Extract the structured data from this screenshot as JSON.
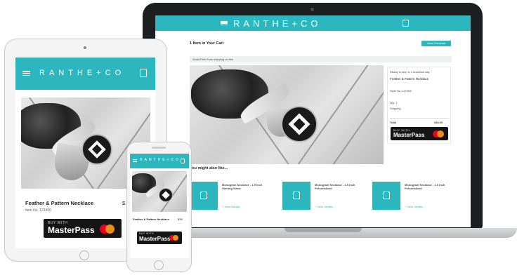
{
  "brand": {
    "logo": "RANTHE+CO"
  },
  "laptop": {
    "cart_title": "1 Item in Your Cart",
    "checkout_label": "View Checkout",
    "notice": "Great Pick! Free shipping on this",
    "product": {
      "ready_text": "Ready to ship in 1 business day",
      "name": "Feather & Pattern Necklace",
      "details": "Style No. 121456",
      "qty_label": "Qty: 1",
      "shipping_label": "Shipping",
      "total_label": "Total",
      "total_value": "$38.00"
    },
    "recs_title": "You might also like...",
    "recs": [
      {
        "title": "Monogram Necklace - 1.5 inch Sterling Silver",
        "link": "+ View Details"
      },
      {
        "title": "Monogram Necklace - 1.5 inch Personalized",
        "link": "+ View Details"
      },
      {
        "title": "Monogram Necklace - 1.0 inch Personalized",
        "link": "+ View Details"
      }
    ]
  },
  "tablet": {
    "product_name": "Feather & Pattern Necklace",
    "style_no": "Item No. 121456",
    "price_partial": "$"
  },
  "phone": {
    "product_name": "Feather & Pattern Necklace",
    "price_partial": "$38"
  },
  "masterpass": {
    "top": "BUY WITH",
    "word": "MasterPass"
  },
  "colors": {
    "accent": "#2bb7bd",
    "mc_red": "#eb001b",
    "mc_yellow": "#f79e1b"
  }
}
